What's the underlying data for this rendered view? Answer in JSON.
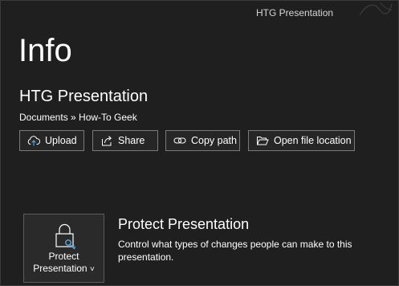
{
  "window": {
    "title": "HTG Presentation"
  },
  "page": {
    "title": "Info"
  },
  "document": {
    "name": "HTG Presentation",
    "breadcrumb": "Documents » How-To Geek"
  },
  "toolbar": {
    "upload_label": "Upload",
    "share_label": "Share",
    "copy_path_label": "Copy path",
    "open_location_label": "Open file location"
  },
  "icons": {
    "upload": "cloud-upload-icon",
    "share": "share-icon",
    "copy_path": "link-icon",
    "open_location": "folder-open-icon",
    "protect": "lock-key-icon"
  },
  "protect": {
    "button_line1": "Protect",
    "button_line2": "Presentation",
    "button_caret": "˅",
    "heading": "Protect Presentation",
    "description": "Control what types of changes people can make to this presentation."
  },
  "colors": {
    "background": "#1f1f1f",
    "button_border": "#7a7a7a",
    "key_accent": "#5aa9e6"
  }
}
